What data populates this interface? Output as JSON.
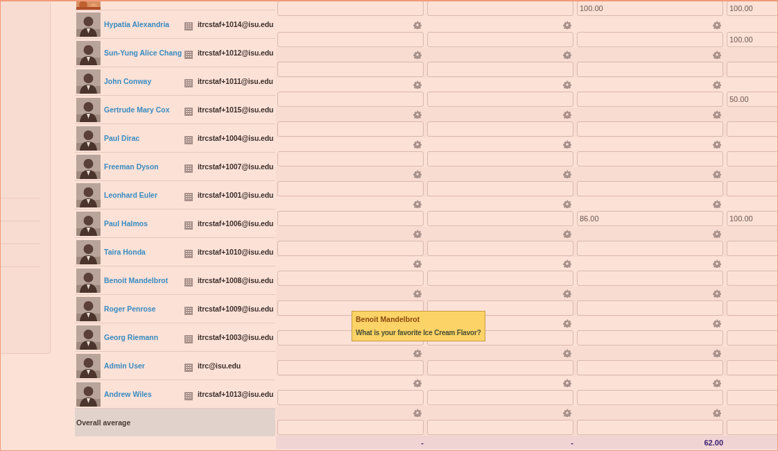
{
  "top_row": {
    "grades": {
      "column_3": "100.00",
      "column_4": "100.00"
    }
  },
  "students": [
    {
      "name": "Hypatia Alexandria",
      "email": "itrcstaf+1014@isu.edu",
      "grades": {
        "column_4": "100.00"
      }
    },
    {
      "name": "Sun-Yung Alice Chang",
      "email": "itrcstaf+1012@isu.edu"
    },
    {
      "name": "John Conway",
      "email": "itrcstaf+1011@isu.edu",
      "grades": {
        "column_4": "50.00"
      }
    },
    {
      "name": "Gertrude Mary Cox",
      "email": "itrcstaf+1015@isu.edu"
    },
    {
      "name": "Paul Dirac",
      "email": "itrcstaf+1004@isu.edu"
    },
    {
      "name": "Freeman Dyson",
      "email": "itrcstaf+1007@isu.edu"
    },
    {
      "name": "Leonhard Euler",
      "email": "itrcstaf+1001@isu.edu",
      "grades": {
        "column_3": "86.00",
        "column_4": "100.00"
      }
    },
    {
      "name": "Paul Halmos",
      "email": "itrcstaf+1006@isu.edu"
    },
    {
      "name": "Taira Honda",
      "email": "itrcstaf+1010@isu.edu"
    },
    {
      "name": "Benoit Mandelbrot",
      "email": "itrcstaf+1008@isu.edu"
    },
    {
      "name": "Roger Penrose",
      "email": "itrcstaf+1009@isu.edu"
    },
    {
      "name": "Georg Riemann",
      "email": "itrcstaf+1003@isu.edu"
    },
    {
      "name": "Admin User",
      "email": "itrc@isu.edu"
    },
    {
      "name": "Andrew Wiles",
      "email": "itrcstaf+1013@isu.edu"
    }
  ],
  "overall": {
    "label": "Overall average",
    "averages": [
      "-",
      "-",
      "62.00"
    ]
  },
  "tooltip": {
    "title": "Benoit Mandelbrot",
    "text": "What is your favorite Ice Cream Flavor?"
  }
}
